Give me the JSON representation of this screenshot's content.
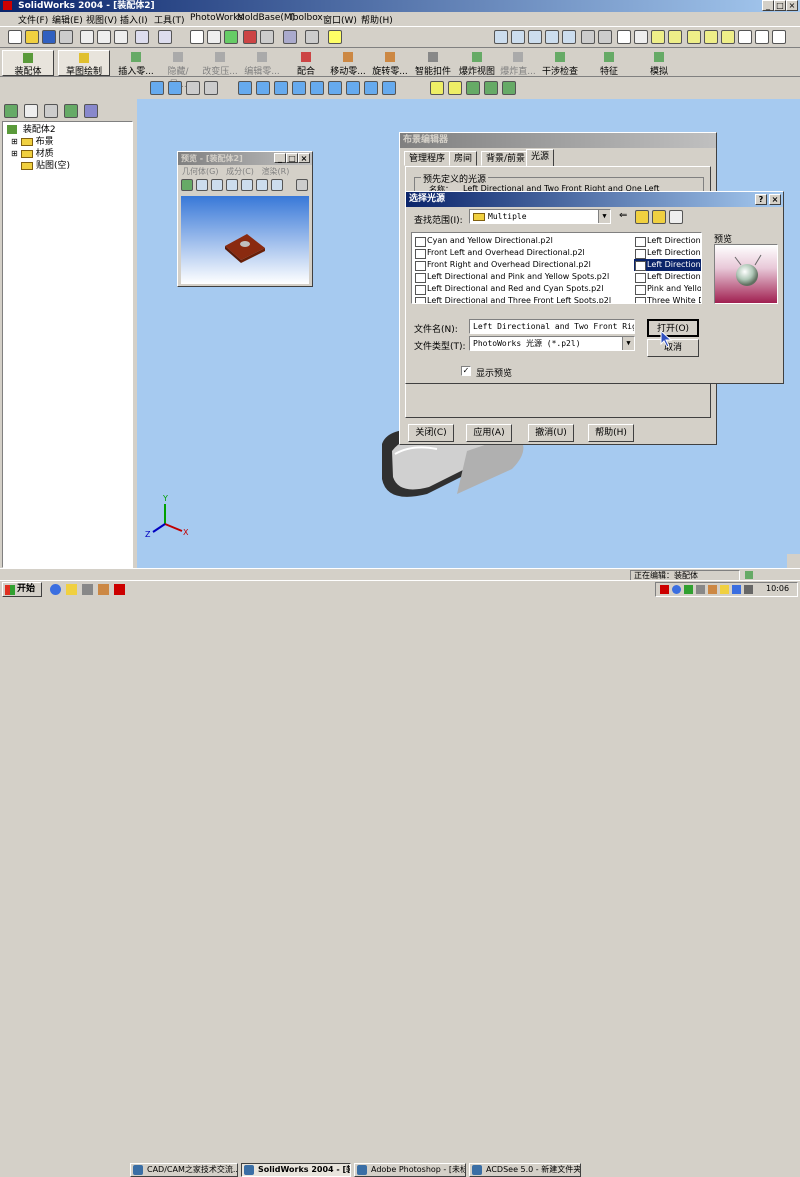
{
  "app": {
    "title": "SolidWorks 2004 - [装配体2]"
  },
  "menu": [
    "文件(F)",
    "编辑(E)",
    "视图(V)",
    "插入(I)",
    "工具(T)",
    "PhotoWorks",
    "MoldBase(M)",
    "Toolbox",
    "窗口(W)",
    "帮助(H)"
  ],
  "command_manager": {
    "assembly": "装配体",
    "sketch": "草图绘制",
    "buttons": [
      "插入零...",
      "隐藏/显...",
      "改变压...",
      "编辑零...",
      "配合",
      "移动零...",
      "旋转零...",
      "智能扣件",
      "爆炸视图",
      "爆炸直...",
      "干涉检查",
      "特征",
      "模拟"
    ]
  },
  "tree": {
    "root": "装配体2",
    "items": [
      "布景",
      "材质",
      "贴图(空)"
    ]
  },
  "preview": {
    "title": "预览 - [装配体2]",
    "menu": [
      "几何体(G)",
      "成分(C)",
      "渲染(R)"
    ]
  },
  "scene_editor": {
    "title": "布景编辑器",
    "tabs": [
      "管理程序",
      "房间",
      "背景/前景",
      "光源"
    ],
    "group_label": "预先定义的光源",
    "name_label": "名称：",
    "name_value": "Left Directional and Two Front Right and One Left",
    "buttons": [
      "关闭(C)",
      "应用(A)",
      "撤消(U)",
      "帮助(H)"
    ]
  },
  "file_dialog": {
    "title": "选择光源",
    "look_in_label": "查找范围(I):",
    "look_in_value": "Multiple",
    "files_col1": [
      "Cyan and Yellow Directional.p2l",
      "Front Left and Overhead Directional.p2l",
      "Front Right and Overhead Directional.p2l",
      "Left Directional and Pink and Yellow Spots.p2l",
      "Left Directional and Red and Cyan Spots.p2l",
      "Left Directional and Three Front Left Spots.p2l"
    ],
    "files_col2": [
      "Left Directional an",
      "Left Directional an",
      "Left Directional an",
      "Left Directional an",
      "Pink and Yellow S",
      "Three White Direc"
    ],
    "selected_index": 2,
    "preview_label": "预览",
    "filename_label": "文件名(N):",
    "filename_value": "Left Directional and Two Front Right an",
    "filetype_label": "文件类型(T):",
    "filetype_value": "PhotoWorks 光源 (*.p2l)",
    "open_button": "打开(O)",
    "cancel_button": "取消",
    "show_preview_label": "显示预览",
    "show_preview_checked": true
  },
  "status": {
    "editing": "正在编辑：装配体"
  },
  "taskbar": {
    "start": "开始",
    "tasks": [
      "CAD/CAM之家技术交流...",
      "SolidWorks 2004 - [装配...",
      "Adobe Photoshop - [未标...",
      "ACDSee 5.0 - 新建文件夹"
    ],
    "clock": "10:06"
  },
  "colors": {
    "titlebar": "#0a246a",
    "viewport": "#a6caf0",
    "selection": "#0a246a"
  }
}
